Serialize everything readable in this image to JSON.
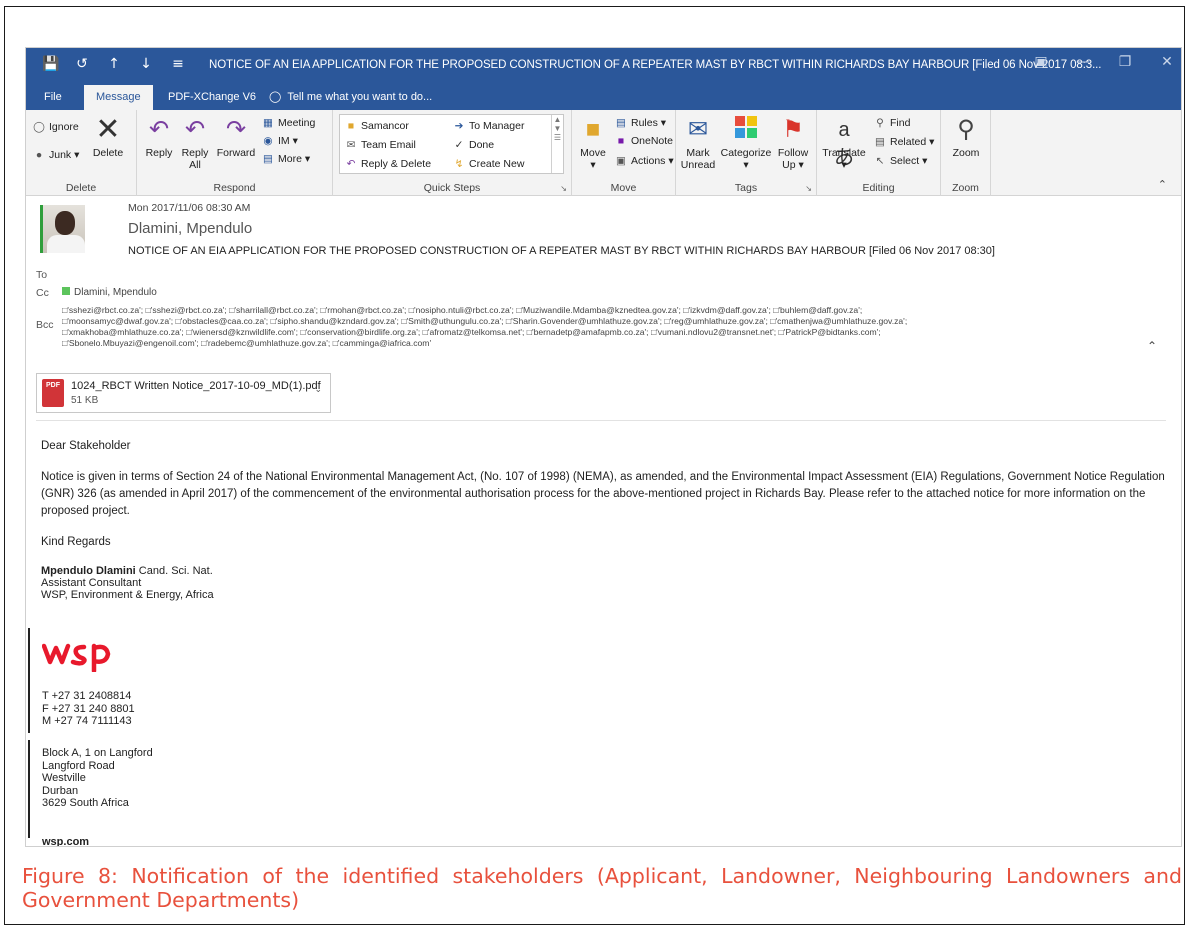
{
  "window": {
    "title": "NOTICE OF AN  EIA APPLICATION FOR THE PROPOSED CONSTRUCTION OF  A REPEATER MAST  BY RBCT WITHIN RICHARDS BAY HARBOUR [Filed 06 Nov 2017 08:3..."
  },
  "tabs": [
    {
      "label": "File"
    },
    {
      "label": "Message"
    },
    {
      "label": "PDF-XChange V6"
    },
    {
      "label": "Tell me what you want to do..."
    }
  ],
  "ribbon": {
    "delete": {
      "label": "Delete",
      "ignore": "Ignore",
      "junk": "Junk",
      "delete_btn": "Delete"
    },
    "respond": {
      "label": "Respond",
      "reply": "Reply",
      "reply_all_1": "Reply",
      "reply_all_2": "All",
      "forward": "Forward",
      "meeting": "Meeting",
      "im": "IM",
      "more": "More"
    },
    "quick_steps": {
      "label": "Quick Steps",
      "items": [
        "Samancor",
        "To Manager",
        "Team Email",
        "Done",
        "Reply & Delete",
        "Create New"
      ]
    },
    "move": {
      "label": "Move",
      "move_btn": "Move",
      "rules": "Rules",
      "onenote": "OneNote",
      "actions": "Actions"
    },
    "tags": {
      "label": "Tags",
      "mark_unread_1": "Mark",
      "mark_unread_2": "Unread",
      "categorize": "Categorize",
      "follow_up_1": "Follow",
      "follow_up_2": "Up"
    },
    "editing": {
      "label": "Editing",
      "translate": "Translate",
      "find": "Find",
      "related": "Related",
      "select": "Select"
    },
    "zoom": {
      "label": "Zoom",
      "zoom_btn": "Zoom"
    }
  },
  "message": {
    "date": "Mon 2017/11/06 08:30 AM",
    "sender": "Dlamini, Mpendulo",
    "subject": "NOTICE OF AN  EIA APPLICATION FOR THE PROPOSED CONSTRUCTION OF  A REPEATER MAST  BY RBCT WITHIN RICHARDS BAY HARBOUR [Filed 06 Nov 2017 08:30]",
    "to_label": "To",
    "cc_label": "Cc",
    "cc_value": "Dlamini, Mpendulo",
    "bcc_label": "Bcc",
    "bcc_lines": [
      "□'sshezi@rbct.co.za'; □'sshezi@rbct.co.za'; □'sharrilall@rbct.co.za'; □'rmohan@rbct.co.za'; □'nosipho.ntuli@rbct.co.za'; □'Muziwandile.Mdamba@kznedtea.gov.za'; □'izkvdm@daff.gov.za'; □'buhlem@daff.gov.za';",
      "□'moonsamyc@dwaf.gov.za'; □'obstacles@caa.co.za'; □'sipho.shandu@kzndard.gov.za'; □'Smith@uthungulu.co.za'; □'Sharin.Govender@umhlathuze.gov.za'; □'reg@umhlathuze.gov.za'; □'cmathenjwa@umhlathuze.gov.za';",
      "□'xmakhoba@mhlathuze.co.za'; □'wienersd@kznwildlife.com'; □'conservation@birdlife.org.za'; □'afromatz@telkomsa.net'; □'bernadetp@amafapmb.co.za'; □'vumani.ndlovu2@transnet.net'; □'PatrickP@bidtanks.com';",
      "□'Sbonelo.Mbuyazi@engenoil.com'; □'radebemc@umhlathuze.gov.za'; □'camminga@iafrica.com'"
    ],
    "attachment": {
      "name": "1024_RBCT Written Notice_2017-10-09_MD(1).pdf",
      "size": "51 KB",
      "icon_text": "PDF"
    },
    "greeting": "Dear Stakeholder",
    "body": "Notice is given in terms of Section 24 of the National Environmental Management Act, (No. 107 of 1998) (NEMA), as amended, and the Environmental Impact Assessment (EIA) Regulations, Government Notice Regulation (GNR) 326 (as amended in April 2017) of the commencement of the environmental authorisation process for the above-mentioned project in Richards Bay. Please refer to the attached notice for more information on the proposed project.",
    "closing": "Kind Regards",
    "signature": {
      "name": "Mpendulo Dlamini",
      "credentials": " Cand. Sci. Nat.",
      "title": "Assistant Consultant",
      "company": "WSP, Environment & Energy, Africa",
      "logo": "wsp",
      "phone_t": "T +27 31 2408814",
      "phone_f": "F +27 31 240 8801",
      "phone_m": "M +27 74 7111143",
      "addr1": "Block A, 1 on Langford",
      "addr2": "Langford Road",
      "addr3": "Westville",
      "addr4": "Durban",
      "addr5": "3629 South Africa",
      "web": "wsp.com"
    }
  },
  "caption": "Figure 8: Notification of the identified stakeholders (Applicant, Landowner, Neighbouring Landowners and Government Departments)",
  "colors": {
    "titlebar": "#2b579a",
    "caption": "#e8513d",
    "wsp_red": "#e8192c"
  }
}
